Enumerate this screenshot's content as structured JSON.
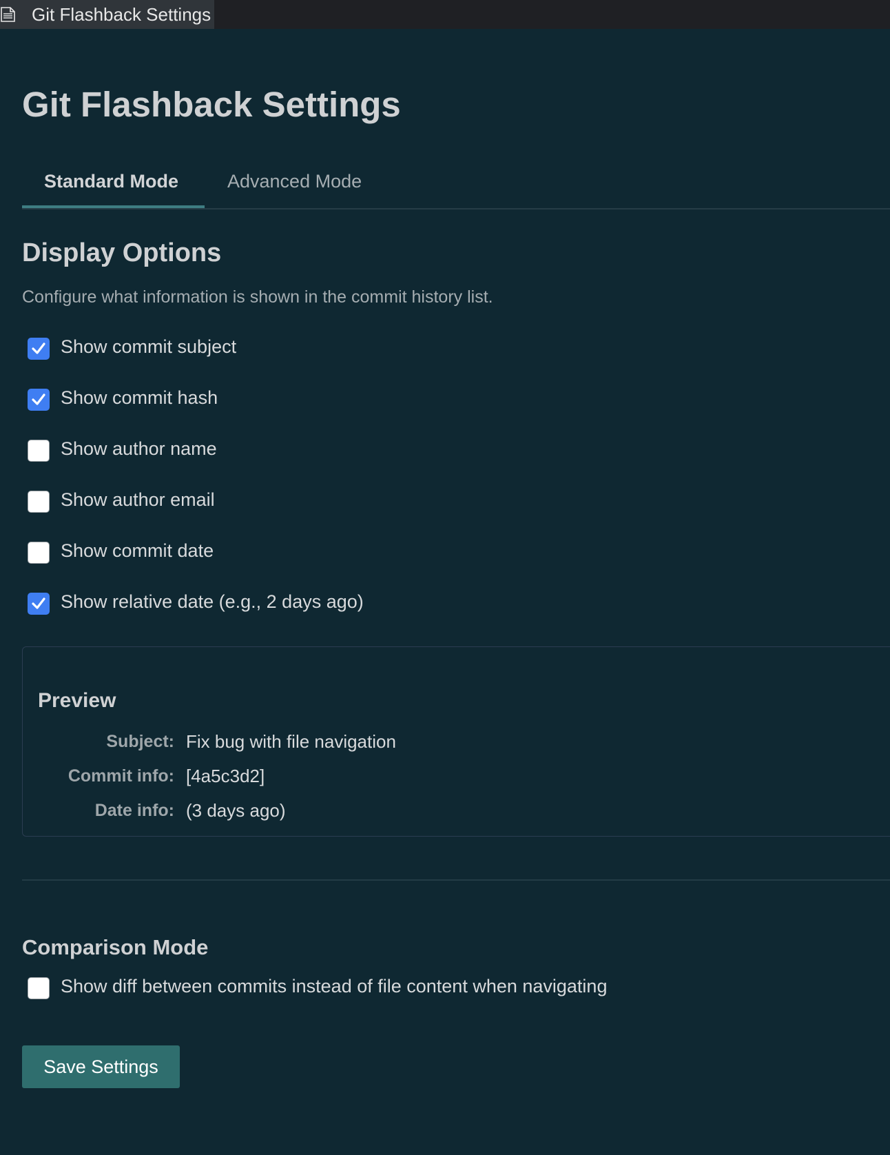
{
  "window": {
    "tab_title": "Git Flashback Settings",
    "tab_icon": "document-icon"
  },
  "page": {
    "title": "Git Flashback Settings"
  },
  "mode_tabs": [
    {
      "label": "Standard Mode",
      "active": true
    },
    {
      "label": "Advanced Mode",
      "active": false
    }
  ],
  "display_options": {
    "title": "Display Options",
    "description": "Configure what information is shown in the commit history list.",
    "options": [
      {
        "label": "Show commit subject",
        "checked": true
      },
      {
        "label": "Show commit hash",
        "checked": true
      },
      {
        "label": "Show author name",
        "checked": false
      },
      {
        "label": "Show author email",
        "checked": false
      },
      {
        "label": "Show commit date",
        "checked": false
      },
      {
        "label": "Show relative date (e.g., 2 days ago)",
        "checked": true
      }
    ]
  },
  "preview": {
    "title": "Preview",
    "rows": [
      {
        "key": "Subject:",
        "value": "Fix bug with file navigation"
      },
      {
        "key": "Commit info:",
        "value": "[4a5c3d2]"
      },
      {
        "key": "Date info:",
        "value": "(3 days ago)"
      }
    ]
  },
  "comparison_mode": {
    "title": "Comparison Mode",
    "option": {
      "label": "Show diff between commits instead of file content when navigating",
      "checked": false
    }
  },
  "actions": {
    "save_label": "Save Settings"
  },
  "colors": {
    "background": "#0f2832",
    "checkbox_checked": "#3f7ef2",
    "save_button": "#2f6e6e",
    "tab_underline": "#3e7d82"
  }
}
